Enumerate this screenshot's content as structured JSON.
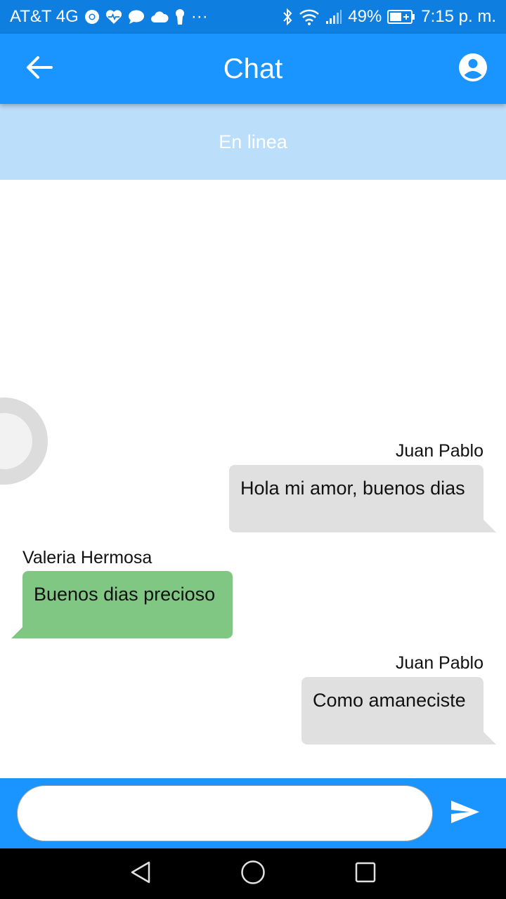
{
  "status_bar": {
    "carrier": "AT&T 4G",
    "more": "···",
    "battery": "49%",
    "time": "7:15 p. m.",
    "icons": [
      "chrome-icon",
      "health-icon",
      "chat-icon",
      "cloud-icon",
      "keyhole-icon",
      "bluetooth-icon",
      "wifi-icon",
      "signal-icon",
      "battery-icon"
    ]
  },
  "app_bar": {
    "title": "Chat",
    "back_icon": "arrow-back-icon",
    "profile_icon": "account-circle-icon"
  },
  "presence": {
    "status": "En linea"
  },
  "messages": [
    {
      "sender": "Juan Pablo",
      "text": "Hola mi amor, buenos dias",
      "direction": "sent"
    },
    {
      "sender": "Valeria Hermosa",
      "text": "Buenos dias precioso",
      "direction": "received"
    },
    {
      "sender": "Juan Pablo",
      "text": "Como amaneciste",
      "direction": "sent"
    }
  ],
  "composer": {
    "value": "",
    "placeholder": "",
    "send_icon": "send-icon"
  },
  "navigation": {
    "icons": [
      "back-triangle-icon",
      "home-circle-icon",
      "recents-square-icon"
    ]
  },
  "colors": {
    "status_bar": "#0e7fe0",
    "app_bar": "#1a95ff",
    "presence_strip": "#bbdefb",
    "sent_bubble": "#e0e0e0",
    "received_bubble": "#81c784"
  }
}
